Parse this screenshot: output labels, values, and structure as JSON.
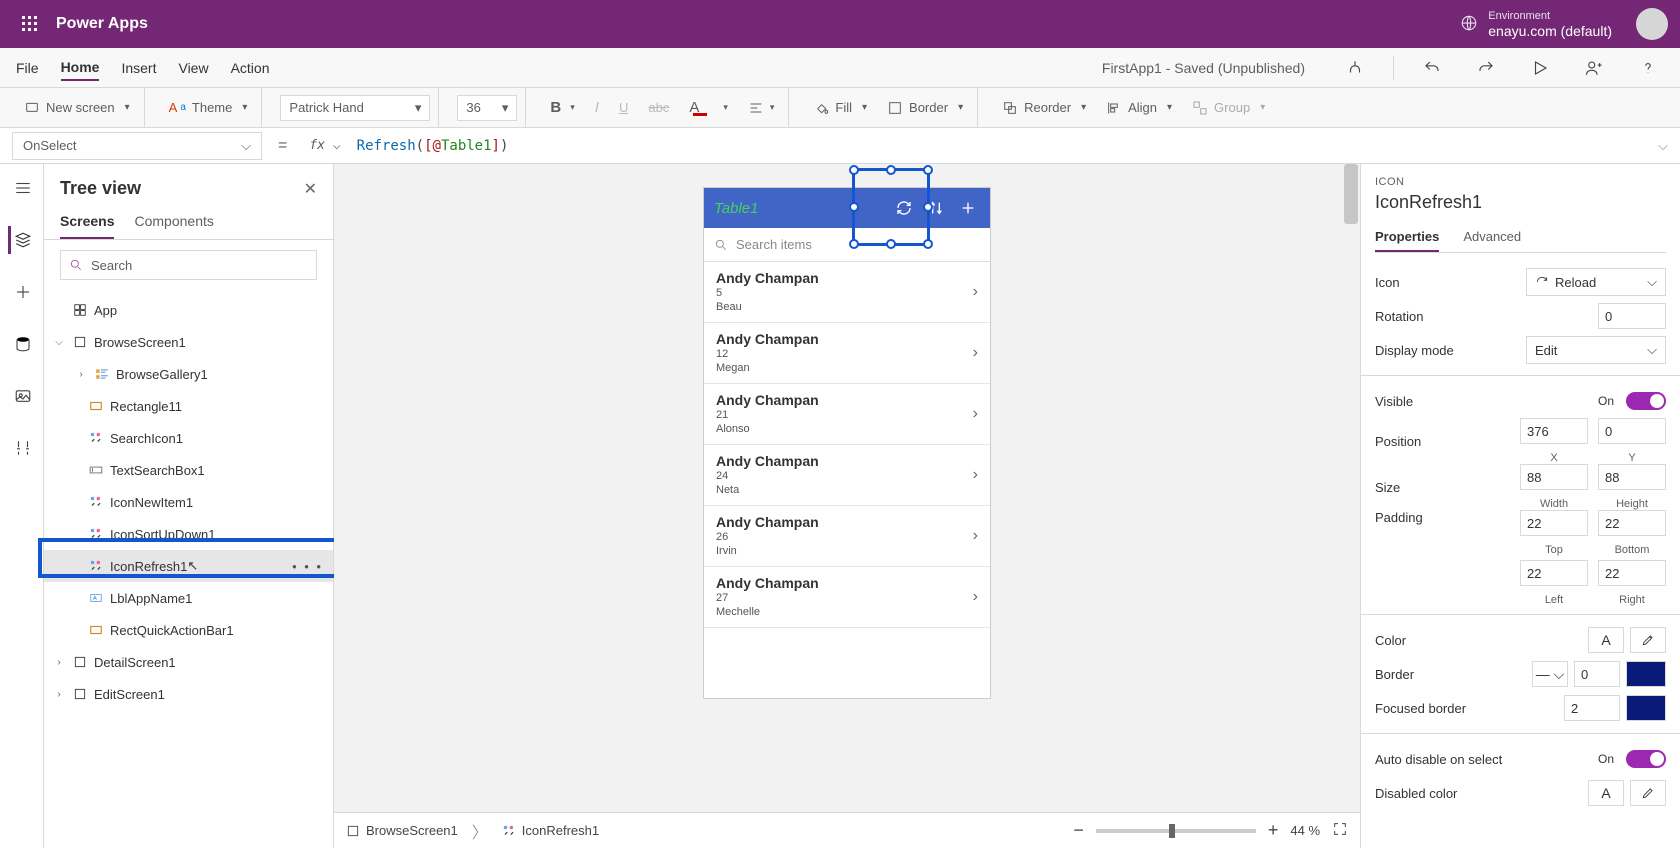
{
  "header": {
    "app_name": "Power Apps",
    "env_label": "Environment",
    "env_value": "enayu.com (default)"
  },
  "menu": {
    "file": "File",
    "home": "Home",
    "insert": "Insert",
    "view": "View",
    "action": "Action",
    "file_status": "FirstApp1 - Saved (Unpublished)"
  },
  "ribbon": {
    "new_screen": "New screen",
    "theme": "Theme",
    "font_name": "Patrick Hand",
    "font_size": "36",
    "fill": "Fill",
    "border": "Border",
    "reorder": "Reorder",
    "align": "Align",
    "group": "Group"
  },
  "formula": {
    "property": "OnSelect",
    "fn": "Refresh",
    "arg_open": "([@",
    "arg_name": "Table1",
    "arg_close": "])"
  },
  "tree": {
    "title": "Tree view",
    "tabs": {
      "screens": "Screens",
      "components": "Components"
    },
    "search_placeholder": "Search",
    "app": "App",
    "browse_screen": "BrowseScreen1",
    "browse_gallery": "BrowseGallery1",
    "rectangle": "Rectangle11",
    "search_icon": "SearchIcon1",
    "text_search": "TextSearchBox1",
    "icon_new": "IconNewItem1",
    "icon_sort": "IconSortUpDown1",
    "icon_refresh": "IconRefresh1",
    "lbl_app": "LblAppName1",
    "rect_quick": "RectQuickActionBar1",
    "detail_screen": "DetailScreen1",
    "edit_screen": "EditScreen1"
  },
  "preview": {
    "title": "Table1",
    "search_placeholder": "Search items",
    "rows": [
      {
        "name": "Andy Champan",
        "n": "5",
        "who": "Beau"
      },
      {
        "name": "Andy Champan",
        "n": "12",
        "who": "Megan"
      },
      {
        "name": "Andy Champan",
        "n": "21",
        "who": "Alonso"
      },
      {
        "name": "Andy Champan",
        "n": "24",
        "who": "Neta"
      },
      {
        "name": "Andy Champan",
        "n": "26",
        "who": "Irvin"
      },
      {
        "name": "Andy Champan",
        "n": "27",
        "who": "Mechelle"
      }
    ]
  },
  "props": {
    "type": "ICON",
    "name": "IconRefresh1",
    "tabs": {
      "properties": "Properties",
      "advanced": "Advanced"
    },
    "icon_lbl": "Icon",
    "icon_val": "Reload",
    "rotation_lbl": "Rotation",
    "rotation_val": "0",
    "display_lbl": "Display mode",
    "display_val": "Edit",
    "visible_lbl": "Visible",
    "visible_val": "On",
    "position_lbl": "Position",
    "x": "376",
    "y": "0",
    "x_cap": "X",
    "y_cap": "Y",
    "size_lbl": "Size",
    "w": "88",
    "h": "88",
    "w_cap": "Width",
    "h_cap": "Height",
    "padding_lbl": "Padding",
    "pt": "22",
    "pb": "22",
    "pl": "22",
    "pr": "22",
    "pt_cap": "Top",
    "pb_cap": "Bottom",
    "pl_cap": "Left",
    "pr_cap": "Right",
    "color_lbl": "Color",
    "border_lbl": "Border",
    "border_val": "0",
    "focused_lbl": "Focused border",
    "focused_val": "2",
    "autodis_lbl": "Auto disable on select",
    "autodis_val": "On",
    "discolor_lbl": "Disabled color"
  },
  "status": {
    "crumb1": "BrowseScreen1",
    "crumb2": "IconRefresh1",
    "zoom": "44",
    "zoom_suffix": "%"
  }
}
